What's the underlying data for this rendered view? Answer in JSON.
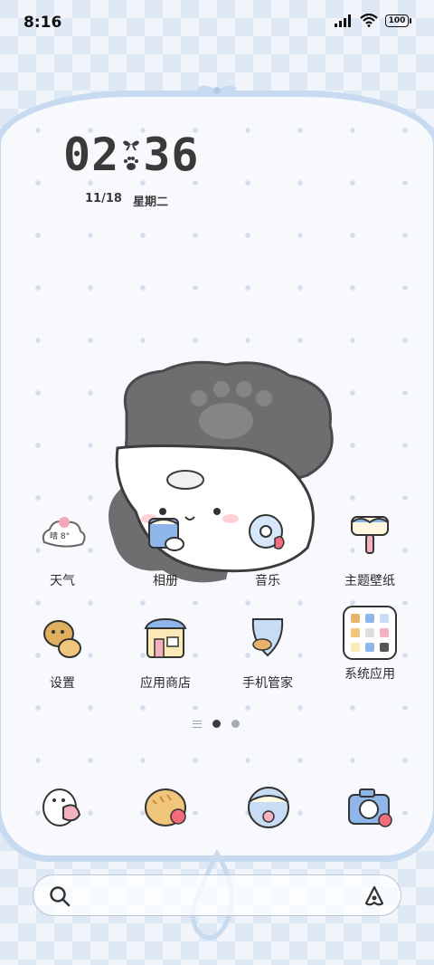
{
  "status": {
    "time": "8:16",
    "battery": "100"
  },
  "clock_widget": {
    "hour": "02",
    "minute": "36",
    "date": "11/18",
    "weekday": "星期二"
  },
  "apps": [
    {
      "label": "天气",
      "icon": "weather-icon",
      "badge": "晴 8°"
    },
    {
      "label": "相册",
      "icon": "gallery-icon"
    },
    {
      "label": "音乐",
      "icon": "music-icon"
    },
    {
      "label": "主题壁纸",
      "icon": "themes-icon"
    },
    {
      "label": "设置",
      "icon": "settings-icon"
    },
    {
      "label": "应用商店",
      "icon": "app-store-icon"
    },
    {
      "label": "手机管家",
      "icon": "phone-manager-icon"
    },
    {
      "label": "系统应用",
      "icon": "system-apps-folder-icon"
    }
  ],
  "page_indicator": {
    "pages": 2,
    "current": 1
  },
  "dock": [
    {
      "icon": "phone-icon"
    },
    {
      "icon": "messages-icon"
    },
    {
      "icon": "browser-icon"
    },
    {
      "icon": "camera-icon"
    }
  ],
  "colors": {
    "accent": "#c7daef",
    "text": "#2b2b2b",
    "mascot_gray": "#6e6e70"
  }
}
